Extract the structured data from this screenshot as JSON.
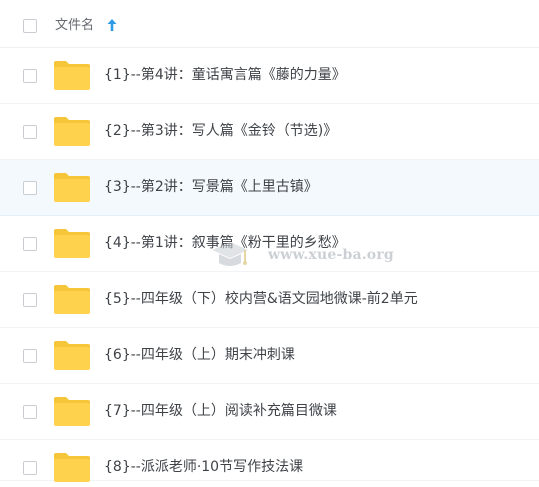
{
  "header": {
    "column_label": "文件名",
    "sort_icon": "arrow-up-icon",
    "accent_color": "#2e9be6"
  },
  "files": [
    {
      "name": "{1}--第4讲：童话寓言篇《藤的力量》",
      "icon": "folder-icon"
    },
    {
      "name": "{2}--第3讲：写人篇《金铃（节选)》",
      "icon": "folder-icon"
    },
    {
      "name": "{3}--第2讲：写景篇《上里古镇》",
      "icon": "folder-icon",
      "hovered": true
    },
    {
      "name": "{4}--第1讲：叙事篇《粉干里的乡愁》",
      "icon": "folder-icon"
    },
    {
      "name": "{5}--四年级（下）校内营&语文园地微课-前2单元",
      "icon": "folder-icon"
    },
    {
      "name": "{6}--四年级（上）期末冲刺课",
      "icon": "folder-icon"
    },
    {
      "name": "{7}--四年级（上）阅读补充篇目微课",
      "icon": "folder-icon"
    },
    {
      "name": "{8}--派派老师·10节写作技法课",
      "icon": "folder-icon"
    }
  ],
  "watermark": {
    "text": "www.xue-ba.org"
  },
  "colors": {
    "folder": "#ffd24d",
    "folder_tab": "#f7c53a",
    "row_hover": "#f4f9fd",
    "text": "#3f4348"
  }
}
